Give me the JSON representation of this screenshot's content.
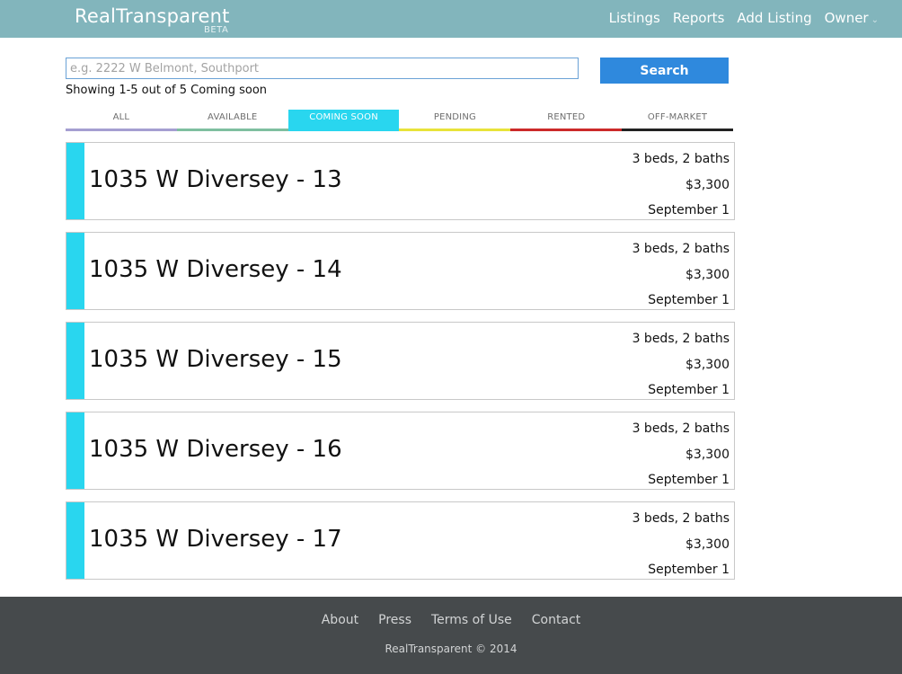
{
  "header": {
    "brand": "RealTransparent",
    "beta": "BETA",
    "nav": [
      "Listings",
      "Reports",
      "Add Listing",
      "Owner"
    ],
    "owner_caret": "⌄"
  },
  "search": {
    "placeholder": "e.g. 2222 W Belmont, Southport",
    "value": "",
    "button_label": "Search",
    "showing_text": "Showing 1-5 out of 5 Coming soon"
  },
  "tabs": [
    {
      "label": "ALL",
      "color": "#a59fd1",
      "active": false
    },
    {
      "label": "AVAILABLE",
      "color": "#7fbfa0",
      "active": false
    },
    {
      "label": "COMING SOON",
      "color": "#29d6ef",
      "active": true
    },
    {
      "label": "PENDING",
      "color": "#e8e33a",
      "active": false
    },
    {
      "label": "RENTED",
      "color": "#cc2a2a",
      "active": false
    },
    {
      "label": "OFF-MARKET",
      "color": "#222222",
      "active": false
    }
  ],
  "listings": [
    {
      "title": "1035 W Diversey - 13",
      "beds_baths": "3 beds, 2 baths",
      "price": "$3,300",
      "available": "September 1"
    },
    {
      "title": "1035 W Diversey - 14",
      "beds_baths": "3 beds, 2 baths",
      "price": "$3,300",
      "available": "September 1"
    },
    {
      "title": "1035 W Diversey - 15",
      "beds_baths": "3 beds, 2 baths",
      "price": "$3,300",
      "available": "September 1"
    },
    {
      "title": "1035 W Diversey - 16",
      "beds_baths": "3 beds, 2 baths",
      "price": "$3,300",
      "available": "September 1"
    },
    {
      "title": "1035 W Diversey - 17",
      "beds_baths": "3 beds, 2 baths",
      "price": "$3,300",
      "available": "September 1"
    }
  ],
  "footer": {
    "links": [
      "About",
      "Press",
      "Terms of Use",
      "Contact"
    ],
    "copyright": "RealTransparent © 2014"
  },
  "colors": {
    "topbar": "#82b5bc",
    "accent": "#29d6ef",
    "search_button": "#2f89dd",
    "footer": "#464a4c"
  }
}
